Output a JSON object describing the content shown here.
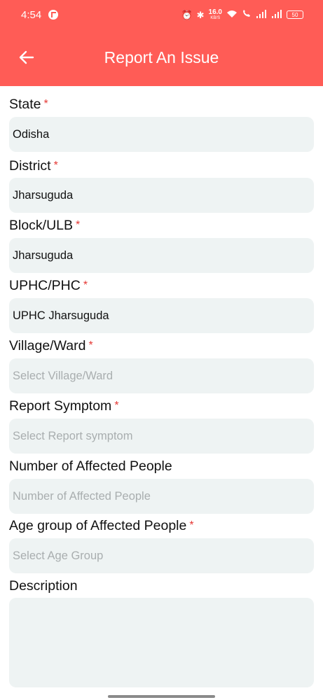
{
  "status_bar": {
    "time": "4:54",
    "net_speed_value": "16.0",
    "net_speed_unit": "KB/S",
    "battery": "50"
  },
  "app_bar": {
    "title": "Report An Issue",
    "color": "#ff5c56"
  },
  "form": {
    "required_marker": "*",
    "fields": [
      {
        "label": "State",
        "value": "Odisha"
      },
      {
        "label": "District",
        "value": "Jharsuguda"
      },
      {
        "label": "Block/ULB",
        "value": "Jharsuguda"
      },
      {
        "label": "UPHC/PHC",
        "value": "UPHC Jharsuguda"
      },
      {
        "label": "Village/Ward",
        "placeholder": "Select Village/Ward"
      },
      {
        "label": "Report Symptom",
        "placeholder": "Select Report symptom"
      },
      {
        "label": "Number of Affected People",
        "placeholder": "Number of Affected People"
      },
      {
        "label": "Age group of Affected People",
        "placeholder": "Select Age Group"
      },
      {
        "label": "Description"
      }
    ]
  }
}
